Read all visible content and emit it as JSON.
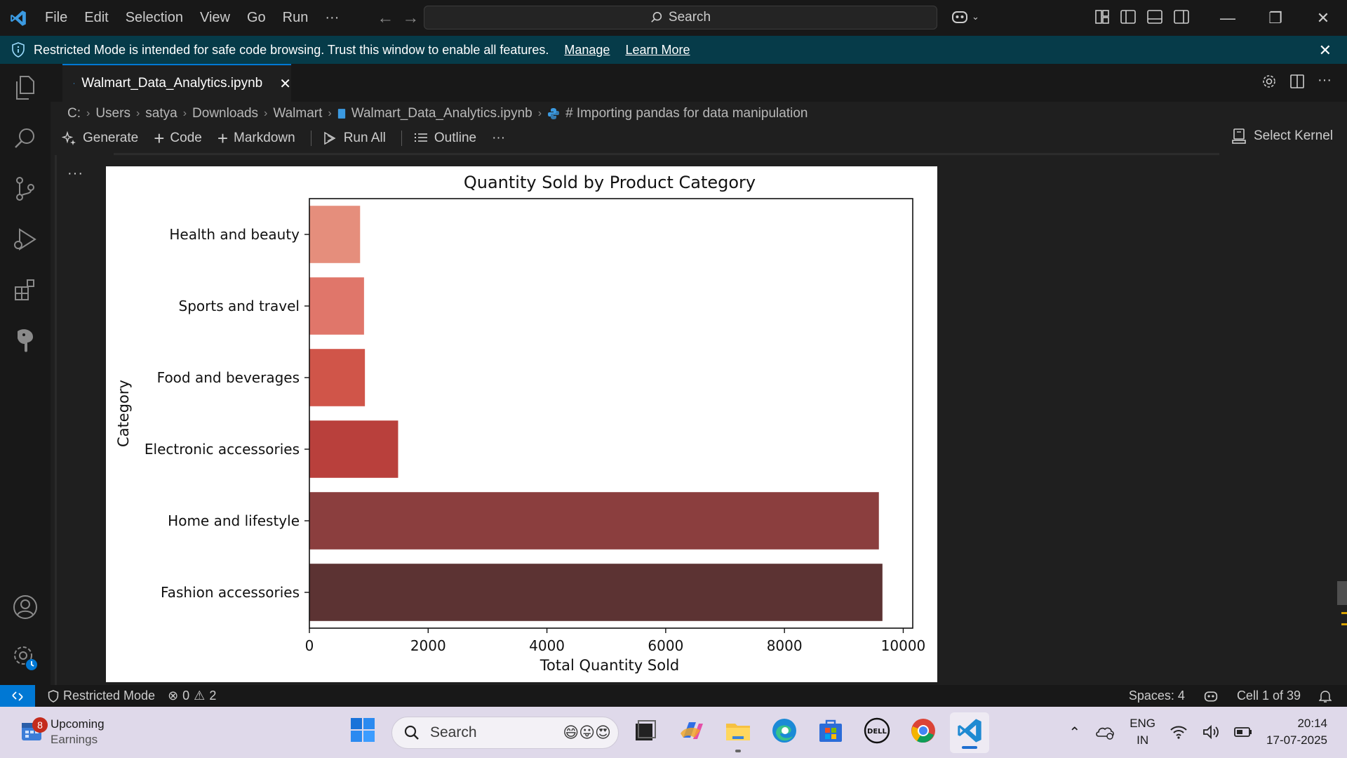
{
  "menu": [
    "File",
    "Edit",
    "Selection",
    "View",
    "Go",
    "Run",
    "···"
  ],
  "search": {
    "label": "Search"
  },
  "banner": {
    "message": "Restricted Mode is intended for safe code browsing. Trust this window to enable all features.",
    "manage": "Manage",
    "learn_more": "Learn More"
  },
  "tab": {
    "title": "Walmart_Data_Analytics.ipynb"
  },
  "breadcrumb": [
    "C:",
    "Users",
    "satya",
    "Downloads",
    "Walmart",
    "Walmart_Data_Analytics.ipynb",
    "# Importing pandas for data manipulation"
  ],
  "toolbar": {
    "generate": "Generate",
    "code": "Code",
    "markdown": "Markdown",
    "run_all": "Run All",
    "outline": "Outline",
    "more": "···",
    "select_kernel": "Select Kernel"
  },
  "cell": {
    "more": "···"
  },
  "chart_data": {
    "type": "bar",
    "orientation": "horizontal",
    "title": "Quantity Sold by Product Category",
    "xlabel": "Total Quantity Sold",
    "ylabel": "Category",
    "categories": [
      "Health and beauty",
      "Sports and travel",
      "Food and beverages",
      "Electronic accessories",
      "Home and lifestyle",
      "Fashion accessories"
    ],
    "values": [
      854,
      920,
      935,
      1494,
      9590,
      9650
    ],
    "colors": [
      "#e58e7c",
      "#e0766a",
      "#d05549",
      "#b9403c",
      "#8b3e3e",
      "#5c3333"
    ],
    "xlim": [
      0,
      10160
    ],
    "xticks": [
      0,
      2000,
      4000,
      6000,
      8000,
      10000
    ],
    "xtick_labels": [
      "0",
      "2000",
      "4000",
      "6000",
      "8000",
      "10000"
    ],
    "grid": false
  },
  "status": {
    "restricted": "Restricted Mode",
    "errors": "0",
    "warnings": "2",
    "spaces": "Spaces: 4",
    "cell": "Cell 1 of 39"
  },
  "taskbar": {
    "widget_title": "Upcoming",
    "widget_sub": "Earnings",
    "badge": "8",
    "search": "Search",
    "lang1": "ENG",
    "lang2": "IN",
    "time": "20:14",
    "date": "17-07-2025"
  }
}
